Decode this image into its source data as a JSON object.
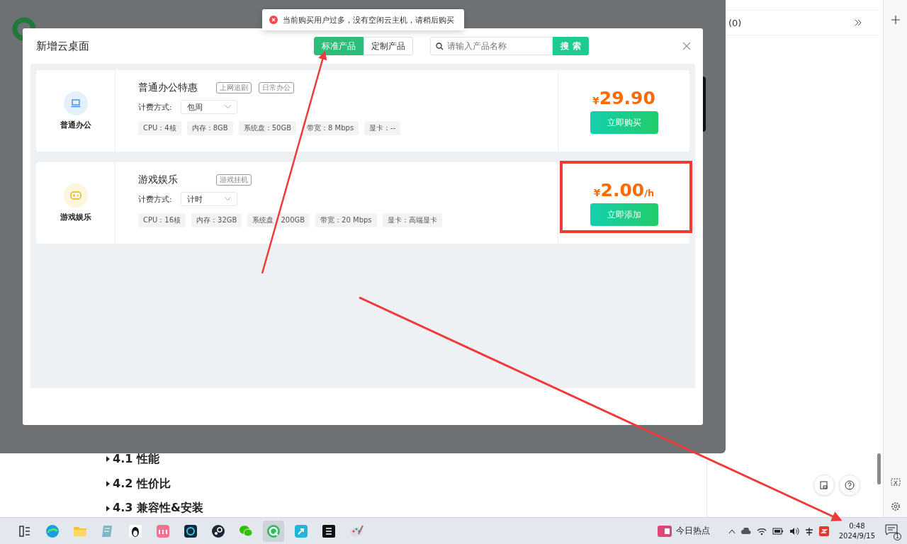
{
  "toast": {
    "kind": "error",
    "text": "当前购买用户过多，没有空闲云主机，请稍后购买"
  },
  "dialog": {
    "title": "新增云桌面",
    "tabs": [
      {
        "label": "标准产品",
        "selected": true
      },
      {
        "label": "定制产品",
        "selected": false
      }
    ],
    "search": {
      "placeholder": "请输入产品名称",
      "button": "搜 索"
    },
    "products": [
      {
        "kind": "office",
        "category": "普通办公",
        "name": "普通办公特惠",
        "tags": [
          "上网追剧",
          "日常办公"
        ],
        "billing_label": "计费方式:",
        "billing": "包周",
        "specs": [
          "CPU：4核",
          "内存：8GB",
          "系统盘：50GB",
          "带宽：8 Mbps",
          "显卡：--"
        ],
        "currency": "¥",
        "price": "29.90",
        "action": "立即购买"
      },
      {
        "kind": "game",
        "category": "游戏娱乐",
        "name": "游戏娱乐",
        "tags": [
          "游戏挂机"
        ],
        "billing_label": "计费方式:",
        "billing": "计时",
        "specs": [
          "CPU：16核",
          "内存：32GB",
          "系统盘：200GB",
          "带宽：20 Mbps",
          "显卡：高端显卡"
        ],
        "currency": "¥",
        "price": "2.00",
        "unit": "/h",
        "action": "立即添加"
      }
    ]
  },
  "document": {
    "outline": [
      {
        "label": "4.1 性能",
        "expanded": false
      },
      {
        "label": "4.2 性价比",
        "expanded": false
      },
      {
        "label": "4.3 兼容性&安装",
        "expanded": false
      }
    ]
  },
  "side_panel": {
    "comments": "(0)"
  },
  "taskbar": {
    "apps": [
      {
        "kind": "widgets",
        "selected": false
      },
      {
        "kind": "edge",
        "selected": false
      },
      {
        "kind": "folder",
        "selected": false
      },
      {
        "kind": "notes",
        "selected": false
      },
      {
        "kind": "penguin",
        "selected": false
      },
      {
        "kind": "pink",
        "selected": false
      },
      {
        "kind": "ring",
        "selected": false
      },
      {
        "kind": "steam",
        "selected": false
      },
      {
        "kind": "chat",
        "selected": false
      },
      {
        "kind": "qring",
        "selected": true
      },
      {
        "kind": "teal",
        "selected": false
      },
      {
        "kind": "dark",
        "selected": false
      },
      {
        "kind": "palette",
        "selected": false
      }
    ],
    "news": "今日热点",
    "time": "0:48",
    "date": "2024/9/15",
    "notifications": "1"
  }
}
